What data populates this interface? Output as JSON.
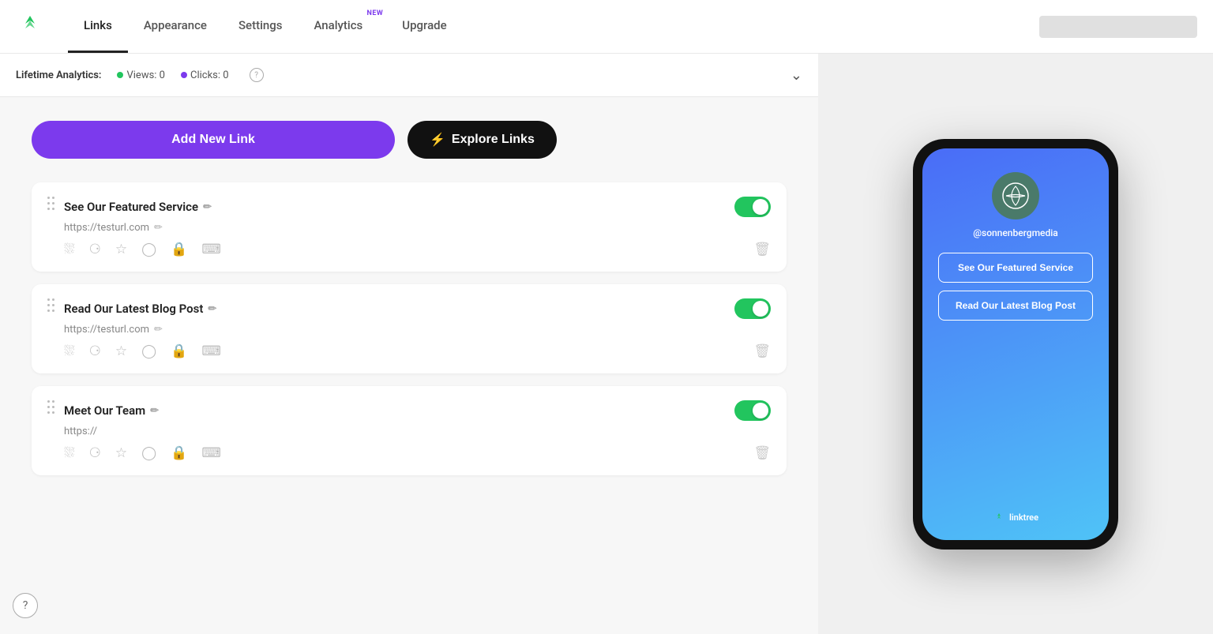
{
  "header": {
    "tabs": [
      {
        "id": "links",
        "label": "Links",
        "active": true,
        "new": false
      },
      {
        "id": "appearance",
        "label": "Appearance",
        "active": false,
        "new": false
      },
      {
        "id": "settings",
        "label": "Settings",
        "active": false,
        "new": false
      },
      {
        "id": "analytics",
        "label": "Analytics",
        "active": false,
        "new": true
      },
      {
        "id": "upgrade",
        "label": "Upgrade",
        "active": false,
        "new": false
      }
    ]
  },
  "analytics_bar": {
    "label": "Lifetime Analytics:",
    "views_label": "Views: 0",
    "clicks_label": "Clicks: 0"
  },
  "buttons": {
    "add_link": "Add New Link",
    "explore_links": "Explore Links"
  },
  "links": [
    {
      "id": "link1",
      "title": "See Our Featured Service",
      "url": "https://testurl.com",
      "enabled": true
    },
    {
      "id": "link2",
      "title": "Read Our Latest Blog Post",
      "url": "https://testurl.com",
      "enabled": true
    },
    {
      "id": "link3",
      "title": "Meet Our Team",
      "url": "https://",
      "enabled": true
    }
  ],
  "phone_preview": {
    "username": "@sonnenbergmedia",
    "link_buttons": [
      "See Our Featured Service",
      "Read Our Latest Blog Post"
    ],
    "footer": "linktree"
  },
  "help": "?"
}
